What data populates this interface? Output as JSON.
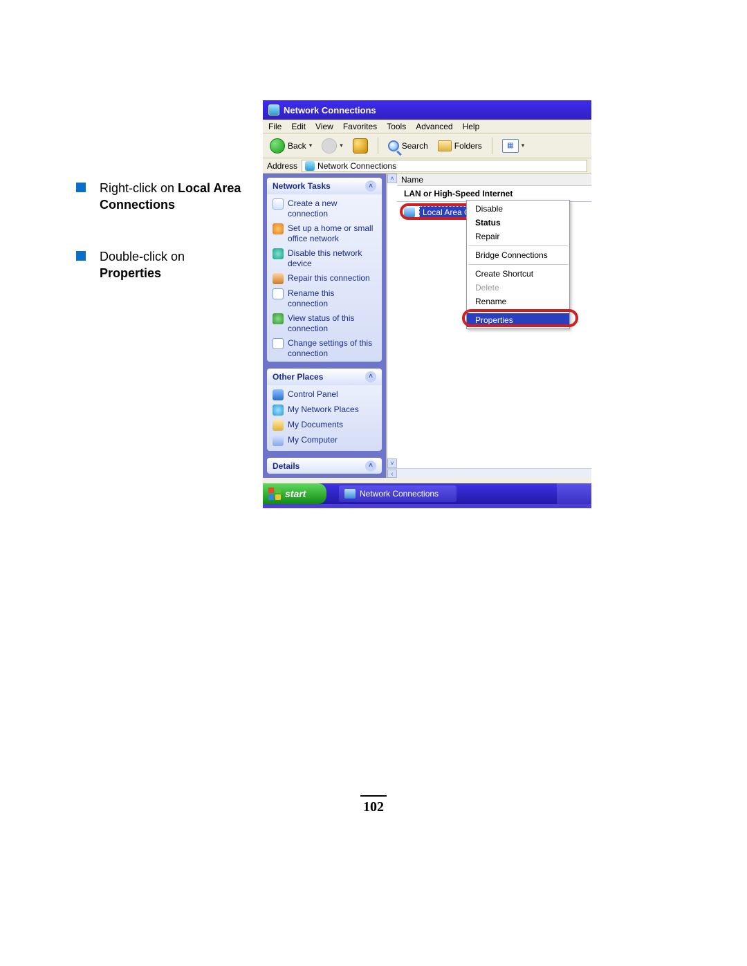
{
  "instructions": [
    {
      "pre": "Right-click on ",
      "bold": "Local Area Connections"
    },
    {
      "pre": "Double-click on ",
      "bold": "Properties"
    }
  ],
  "window": {
    "title": "Network Connections"
  },
  "menubar": [
    "File",
    "Edit",
    "View",
    "Favorites",
    "Tools",
    "Advanced",
    "Help"
  ],
  "toolbar": {
    "back": "Back",
    "search": "Search",
    "folders": "Folders"
  },
  "addressbar": {
    "label": "Address",
    "value": "Network Connections"
  },
  "sidebar": {
    "network_tasks": {
      "title": "Network Tasks",
      "items": [
        "Create a new connection",
        "Set up a home or small office network",
        "Disable this network device",
        "Repair this connection",
        "Rename this connection",
        "View status of this connection",
        "Change settings of this connection"
      ]
    },
    "other_places": {
      "title": "Other Places",
      "items": [
        "Control Panel",
        "My Network Places",
        "My Documents",
        "My Computer"
      ]
    },
    "details": {
      "title": "Details"
    }
  },
  "content": {
    "column_header": "Name",
    "group": "LAN or High-Speed Internet",
    "connection": "Local Area Con"
  },
  "context_menu": {
    "items": [
      {
        "label": "Disable"
      },
      {
        "label": "Status",
        "bold": true
      },
      {
        "label": "Repair"
      },
      {
        "sep": true
      },
      {
        "label": "Bridge Connections"
      },
      {
        "sep": true
      },
      {
        "label": "Create Shortcut"
      },
      {
        "label": "Delete",
        "disabled": true
      },
      {
        "label": "Rename"
      },
      {
        "sep": true
      },
      {
        "label": "Properties",
        "selected": true
      }
    ]
  },
  "taskbar": {
    "start": "start",
    "task": "Network Connections"
  },
  "page_number": "102"
}
